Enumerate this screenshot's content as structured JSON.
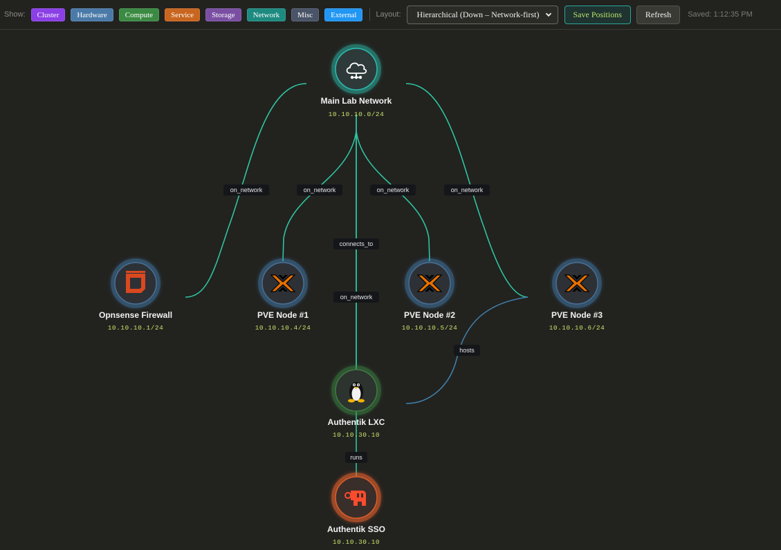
{
  "toolbar": {
    "show_label": "Show:",
    "filters": [
      {
        "label": "Cluster",
        "color": "#8b3fe6"
      },
      {
        "label": "Hardware",
        "color": "#4a7aa8"
      },
      {
        "label": "Compute",
        "color": "#3b8a43"
      },
      {
        "label": "Service",
        "color": "#c8651e"
      },
      {
        "label": "Storage",
        "color": "#7a4fa3"
      },
      {
        "label": "Network",
        "color": "#1d8a80"
      },
      {
        "label": "Misc",
        "color": "#4a5468"
      },
      {
        "label": "External",
        "color": "#2196f3"
      }
    ],
    "layout_label": "Layout:",
    "layout_value": "Hierarchical (Down – Network-first)",
    "save_label": "Save Positions",
    "refresh_label": "Refresh",
    "saved_text": "Saved: 1:12:35 PM"
  },
  "colors": {
    "network_edge": "#2ec4a0",
    "hosts_edge": "#3f7fa8",
    "network_glow": "#2bbfb0",
    "compute_glow": "#3b8a43",
    "service_glow": "#e8612c",
    "hardware_glow": "#4a8ac8"
  },
  "nodes": [
    {
      "id": "net",
      "name": "Main Lab Network",
      "ip": "10.10.10.0/24",
      "icon": "cloud-network-icon",
      "type": "network"
    },
    {
      "id": "opn",
      "name": "Opnsense Firewall",
      "ip": "10.10.10.1/24",
      "icon": "opnsense-icon",
      "type": "hardware"
    },
    {
      "id": "pve1",
      "name": "PVE Node #1",
      "ip": "10.10.10.4/24",
      "icon": "proxmox-icon",
      "type": "hardware"
    },
    {
      "id": "pve2",
      "name": "PVE Node #2",
      "ip": "10.10.10.5/24",
      "icon": "proxmox-icon",
      "type": "hardware"
    },
    {
      "id": "pve3",
      "name": "PVE Node #3",
      "ip": "10.10.10.6/24",
      "icon": "proxmox-icon",
      "type": "hardware"
    },
    {
      "id": "lxc",
      "name": "Authentik LXC",
      "ip": "10.10.30.10",
      "icon": "linux-tux-icon",
      "type": "compute"
    },
    {
      "id": "sso",
      "name": "Authentik SSO",
      "ip": "10.10.30.10",
      "icon": "authentik-icon",
      "type": "service"
    }
  ],
  "edges": [
    {
      "from": "net",
      "to": "opn",
      "label": "on_network"
    },
    {
      "from": "net",
      "to": "pve1",
      "label": "on_network"
    },
    {
      "from": "net",
      "to": "pve2",
      "label": "on_network"
    },
    {
      "from": "net",
      "to": "pve3",
      "label": "on_network"
    },
    {
      "from": "net",
      "to": "lxc",
      "label": "connects_to"
    },
    {
      "from": "lxc",
      "to": "net",
      "label": "on_network"
    },
    {
      "from": "pve3",
      "to": "lxc",
      "label": "hosts"
    },
    {
      "from": "lxc",
      "to": "sso",
      "label": "runs"
    }
  ]
}
